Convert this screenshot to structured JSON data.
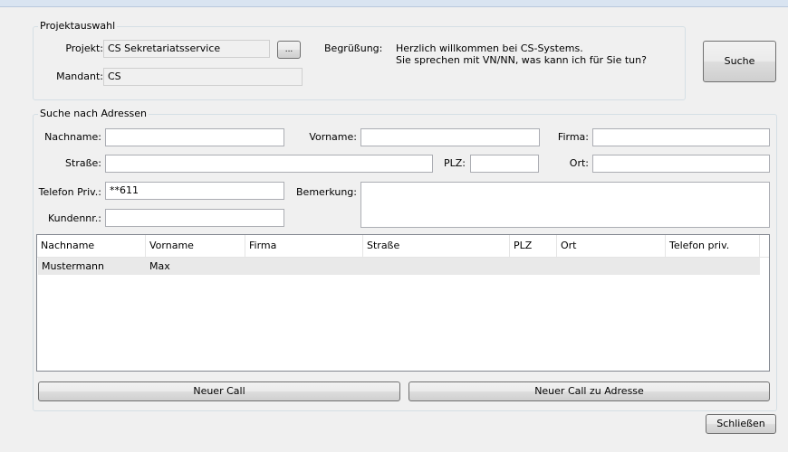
{
  "project_selection": {
    "title": "Projektauswahl",
    "project_label": "Projekt:",
    "project_value": "CS Sekretariatsservice",
    "browse_label": "...",
    "client_label": "Mandant:",
    "client_value": "CS",
    "greeting_label": "Begrüßung:",
    "greeting_line1": "Herzlich willkommen bei CS-Systems.",
    "greeting_line2": "Sie sprechen mit VN/NN, was kann ich für Sie tun?"
  },
  "search_button_label": "Suche",
  "address_search": {
    "title": "Suche nach Adressen",
    "lastname_label": "Nachname:",
    "lastname_value": "",
    "firstname_label": "Vorname:",
    "firstname_value": "",
    "company_label": "Firma:",
    "company_value": "",
    "street_label": "Straße:",
    "street_value": "",
    "zip_label": "PLZ:",
    "zip_value": "",
    "city_label": "Ort:",
    "city_value": "",
    "phone_label": "Telefon Priv.:",
    "phone_value": "**611",
    "remark_label": "Bemerkung:",
    "remark_value": "",
    "customer_no_label": "Kundennr.:",
    "customer_no_value": ""
  },
  "results": {
    "columns": [
      "Nachname",
      "Vorname",
      "Firma",
      "Straße",
      "PLZ",
      "Ort",
      "Telefon priv."
    ],
    "rows": [
      [
        "Mustermann",
        "Max",
        "",
        "",
        "",
        "",
        ""
      ]
    ]
  },
  "actions": {
    "new_call": "Neuer Call",
    "new_call_address": "Neuer Call zu Adresse",
    "close": "Schließen"
  }
}
